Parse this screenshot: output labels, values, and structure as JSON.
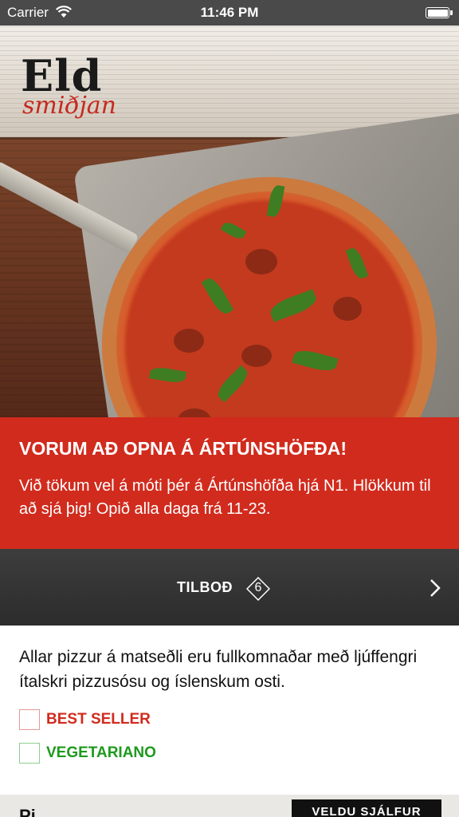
{
  "status_bar": {
    "carrier": "Carrier",
    "time": "11:46 PM"
  },
  "brand": {
    "logo_main": "Eld",
    "logo_sub": "smiðjan",
    "accent_color": "#d12b1d"
  },
  "promo": {
    "title": "VORUM AÐ OPNA Á ÁRTÚNSHÖFÐA!",
    "body": "Við tökum vel á móti þér á Ártúnshöfða hjá N1. Hlökkum til að sjá þig! Opið alla daga frá 11-23."
  },
  "offers": {
    "label": "TILBOÐ",
    "count": "6"
  },
  "info": {
    "text": "Allar pizzur á matseðli eru fullkomnaðar með ljúffengri ítalskri pizzusósu og íslenskum osti."
  },
  "legend": [
    {
      "label": "BEST SELLER",
      "color": "#d12b1d"
    },
    {
      "label": "VEGETARIANO",
      "color": "#1e9a1e"
    }
  ],
  "bottom": {
    "category_title": "Pi",
    "button_label": "VELDU SJÁLFUR"
  },
  "icons": [
    "wifi-icon",
    "battery-icon",
    "chevron-right-icon",
    "logo"
  ]
}
